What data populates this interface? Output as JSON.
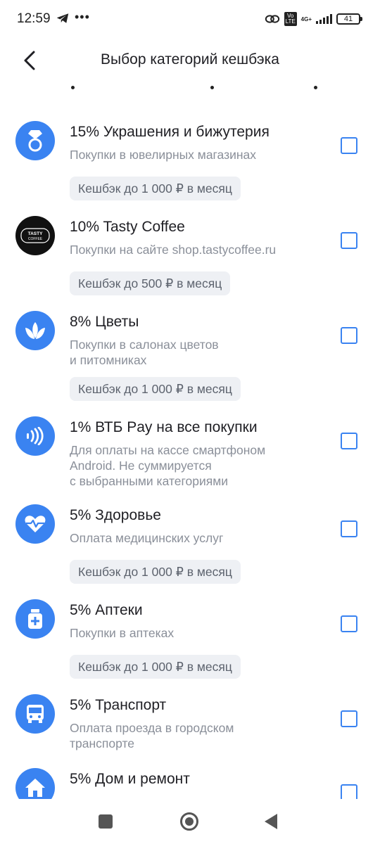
{
  "status_bar": {
    "time": "12:59",
    "more": "•••",
    "volte": "Vo LTE",
    "network": "4G+",
    "battery": "41"
  },
  "header": {
    "title": "Выбор категорий кешбэка",
    "back_icon": "chevron-left-icon"
  },
  "colors": {
    "accent": "#3a83f1",
    "badge_bg": "#eef0f4",
    "secondary_text": "#8a8f99"
  },
  "categories": [
    {
      "icon": "ring-icon",
      "title": "15% Украшения и бижутерия",
      "description": "Покупки в ювелирных магазинах",
      "limit": "Кешбэк до 1 000 ₽ в месяц",
      "checked": false
    },
    {
      "icon": "tasty-coffee-logo",
      "logo_line1": "TASTY",
      "logo_line2": "COFFEE",
      "title": "10% Tasty Coffee",
      "description": "Покупки на сайте shop.tastycoffee.ru",
      "limit": "Кешбэк до 500 ₽ в месяц",
      "checked": false
    },
    {
      "icon": "lotus-flower-icon",
      "title": "8% Цветы",
      "description_line1": "Покупки в салонах цветов",
      "description_line2": "и питомниках",
      "limit": "Кешбэк до 1 000 ₽ в месяц",
      "checked": false
    },
    {
      "icon": "contactless-pay-icon",
      "title": "1% ВТБ Pay на все покупки",
      "description_line1": "Для оплаты на кассе смартфоном",
      "description_line2": "Android. Не суммируется",
      "description_line3": "с выбранными категориями",
      "checked": false
    },
    {
      "icon": "heart-pulse-icon",
      "title": "5% Здоровье",
      "description": "Оплата медицинских услуг",
      "limit": "Кешбэк до 1 000 ₽ в месяц",
      "checked": false
    },
    {
      "icon": "medicine-bottle-icon",
      "title": "5% Аптеки",
      "description": "Покупки в аптеках",
      "limit": "Кешбэк до 1 000 ₽ в месяц",
      "checked": false
    },
    {
      "icon": "bus-icon",
      "title": "5% Транспорт",
      "description_line1": "Оплата проезда в городском",
      "description_line2": "транспорте",
      "checked": false
    },
    {
      "icon": "house-icon",
      "title": "5% Дом и ремонт",
      "checked": false
    }
  ],
  "nav_bar": {
    "recents": "recents-square-icon",
    "home": "home-circle-icon",
    "back": "back-triangle-icon"
  }
}
